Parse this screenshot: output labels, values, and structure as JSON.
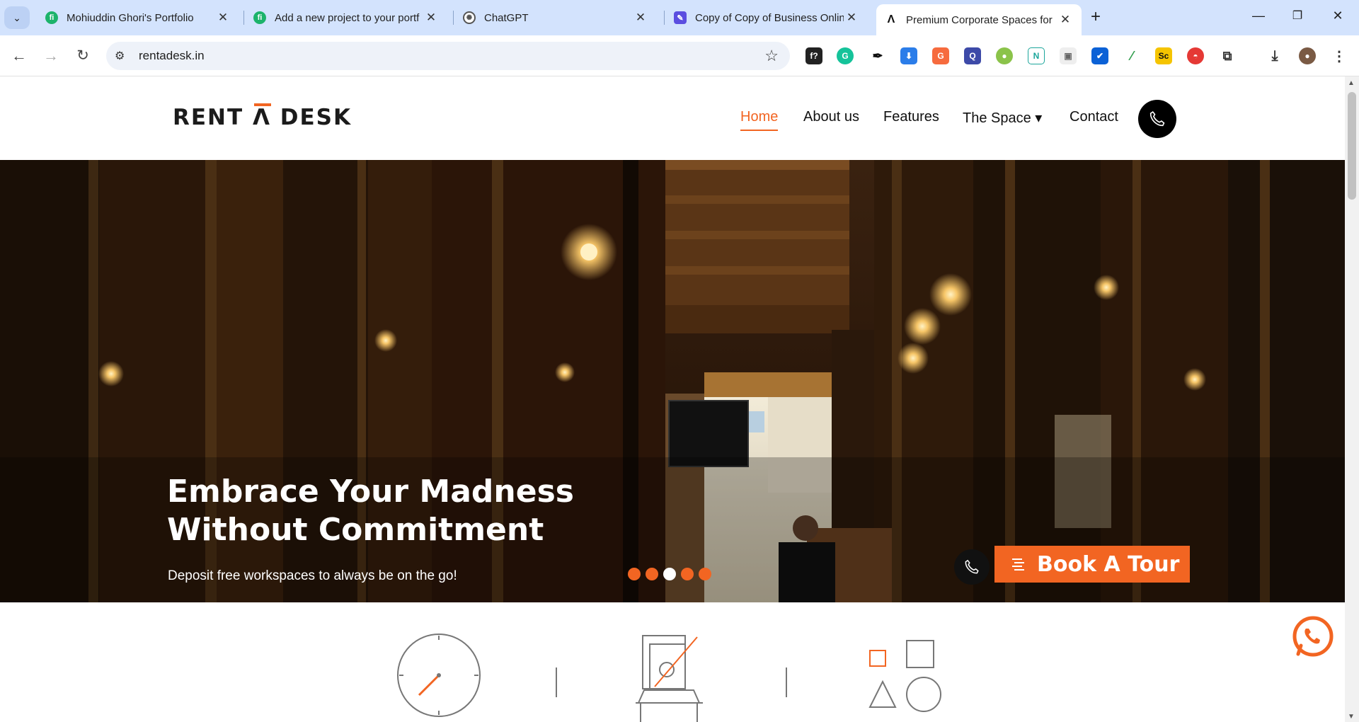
{
  "browser": {
    "tabs": [
      {
        "title": "Mohiuddin Ghori's Portfolio",
        "favicon": "portfolio-icon",
        "color": "#1cb36b"
      },
      {
        "title": "Add a new project to your portf",
        "favicon": "portfolio-icon",
        "color": "#1cb36b"
      },
      {
        "title": "ChatGPT",
        "favicon": "chatgpt-icon",
        "color": "#333333"
      },
      {
        "title": "Copy of Copy of Business Onlin",
        "favicon": "canva-icon",
        "color": "#5b4ee0"
      },
      {
        "title": "Premium Corporate Spaces for",
        "favicon": "rentadesk-icon",
        "color": "#111111"
      }
    ],
    "url": "rentadesk.in"
  },
  "site": {
    "logo": {
      "part1": "RENT",
      "part2": "Λ",
      "part3": "DESK"
    },
    "nav": {
      "home": "Home",
      "about": "About us",
      "features": "Features",
      "space": "The Space ▾",
      "contact": "Contact"
    },
    "hero": {
      "title_line1": "Embrace Your Madness",
      "title_line2": "Without Commitment",
      "subtitle": "Deposit free workspaces to always be on the go!",
      "book_tour": "Book A Tour",
      "slides": 5,
      "active_slide": 3
    }
  },
  "colors": {
    "accent": "#f26522",
    "dark": "#111111"
  }
}
